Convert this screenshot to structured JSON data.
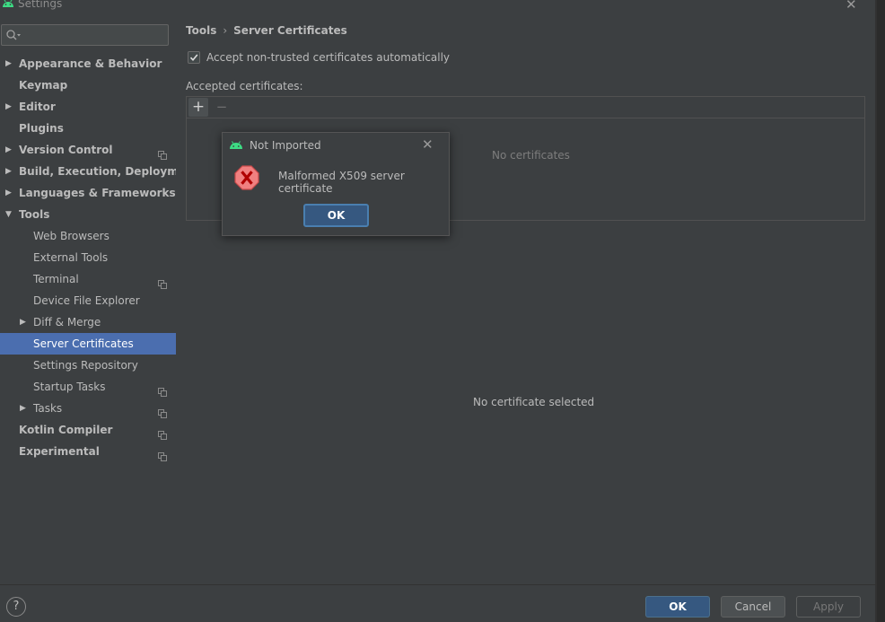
{
  "window": {
    "title": "Settings",
    "close_glyph": "✕"
  },
  "sidebar": {
    "search": {
      "value": "",
      "placeholder": ""
    },
    "items": [
      {
        "label": "Appearance & Behavior",
        "level": 0,
        "bold": true,
        "arrow": "▶",
        "selected": false,
        "project_icon": false
      },
      {
        "label": "Keymap",
        "level": 0,
        "bold": true,
        "arrow": "",
        "selected": false,
        "project_icon": false
      },
      {
        "label": "Editor",
        "level": 0,
        "bold": true,
        "arrow": "▶",
        "selected": false,
        "project_icon": false
      },
      {
        "label": "Plugins",
        "level": 0,
        "bold": true,
        "arrow": "",
        "selected": false,
        "project_icon": false
      },
      {
        "label": "Version Control",
        "level": 0,
        "bold": true,
        "arrow": "▶",
        "selected": false,
        "project_icon": true
      },
      {
        "label": "Build, Execution, Deployment",
        "level": 0,
        "bold": true,
        "arrow": "▶",
        "selected": false,
        "project_icon": false
      },
      {
        "label": "Languages & Frameworks",
        "level": 0,
        "bold": true,
        "arrow": "▶",
        "selected": false,
        "project_icon": false
      },
      {
        "label": "Tools",
        "level": 0,
        "bold": true,
        "arrow": "▼",
        "selected": false,
        "project_icon": false
      },
      {
        "label": "Web Browsers",
        "level": 1,
        "bold": false,
        "arrow": "",
        "selected": false,
        "project_icon": false
      },
      {
        "label": "External Tools",
        "level": 1,
        "bold": false,
        "arrow": "",
        "selected": false,
        "project_icon": false
      },
      {
        "label": "Terminal",
        "level": 1,
        "bold": false,
        "arrow": "",
        "selected": false,
        "project_icon": true
      },
      {
        "label": "Device File Explorer",
        "level": 1,
        "bold": false,
        "arrow": "",
        "selected": false,
        "project_icon": false
      },
      {
        "label": "Diff & Merge",
        "level": 1,
        "bold": false,
        "arrow": "▶",
        "selected": false,
        "project_icon": false
      },
      {
        "label": "Server Certificates",
        "level": 1,
        "bold": false,
        "arrow": "",
        "selected": true,
        "project_icon": false
      },
      {
        "label": "Settings Repository",
        "level": 1,
        "bold": false,
        "arrow": "",
        "selected": false,
        "project_icon": false
      },
      {
        "label": "Startup Tasks",
        "level": 1,
        "bold": false,
        "arrow": "",
        "selected": false,
        "project_icon": true
      },
      {
        "label": "Tasks",
        "level": 1,
        "bold": false,
        "arrow": "▶",
        "selected": false,
        "project_icon": true
      },
      {
        "label": "Kotlin Compiler",
        "level": 0,
        "bold": true,
        "arrow": "",
        "selected": false,
        "project_icon": true
      },
      {
        "label": "Experimental",
        "level": 0,
        "bold": true,
        "arrow": "",
        "selected": false,
        "project_icon": true
      }
    ]
  },
  "content": {
    "breadcrumb": {
      "parent": "Tools",
      "separator": "›",
      "current": "Server Certificates"
    },
    "accept_checkbox": {
      "label": "Accept non-trusted certificates automatically",
      "checked": true
    },
    "accepted_label": "Accepted certificates:",
    "toolbar": {
      "add_glyph": "+",
      "remove_glyph": "−"
    },
    "empty_list": "No certificates",
    "no_selection": "No certificate selected"
  },
  "dialog": {
    "title": "Not Imported",
    "message": "Malformed X509 server certificate",
    "ok_label": "OK",
    "close_glyph": "✕"
  },
  "footer": {
    "help_glyph": "?",
    "ok_label": "OK",
    "cancel_label": "Cancel",
    "apply_label": "Apply",
    "apply_enabled": false
  },
  "colors": {
    "background": "#3c3f41",
    "selection": "#4b6eaf",
    "primary_button": "#365880",
    "android_green": "#3ddc84",
    "error_red": "#e05555"
  },
  "icons": {
    "app": "android-icon",
    "search": "search-icon",
    "error": "error-icon",
    "project": "project-level-icon"
  }
}
